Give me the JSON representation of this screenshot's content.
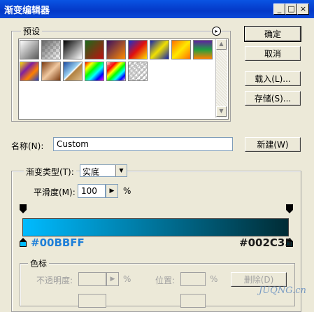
{
  "window": {
    "title": "渐变编辑器",
    "min_glyph": "_",
    "max_glyph": "□",
    "close_glyph": "×"
  },
  "presets": {
    "label": "预设",
    "menu_glyph": "▸",
    "scroll_up": "▲",
    "scroll_down": "▼",
    "swatches": [
      {
        "name": "foreground-to-background",
        "css": "linear-gradient(135deg,#ffffff,#5a5a5a)"
      },
      {
        "name": "foreground-to-transparent",
        "css": "linear-gradient(135deg,#666 0%,rgba(255,255,255,0) 100%)",
        "checker": true
      },
      {
        "name": "black-white",
        "css": "linear-gradient(135deg,#000,#fff)"
      },
      {
        "name": "red-green",
        "css": "linear-gradient(135deg,#1a6a1a,#c01010)"
      },
      {
        "name": "violet-orange",
        "css": "linear-gradient(135deg,#3a1060,#ff8a00)"
      },
      {
        "name": "blue-red-yellow",
        "css": "linear-gradient(135deg,#1530d0,#e01010 50%,#ffe000)"
      },
      {
        "name": "blue-yellow-blue",
        "css": "linear-gradient(135deg,#1020b0,#f0e000 50%,#1020b0)"
      },
      {
        "name": "orange-yellow-orange",
        "css": "linear-gradient(135deg,#ff7000,#ffe800 50%,#ff7000)"
      },
      {
        "name": "violet-green-orange",
        "css": "linear-gradient(180deg,#6020a0,#20a040 50%,#ff8000)"
      },
      {
        "name": "yellow-violet-orange-blue",
        "css": "linear-gradient(135deg,#ffe000,#8020a0 35%,#ff8000 65%,#2040d0)"
      },
      {
        "name": "copper",
        "css": "linear-gradient(135deg,#7a3a10,#f0c8a0 50%,#7a3a10)"
      },
      {
        "name": "chrome",
        "css": "linear-gradient(135deg,#1a4aa0,#9ad0f0 45%,#fff 50%,#b08040 55%,#e0c090)"
      },
      {
        "name": "spectrum",
        "css": "linear-gradient(135deg,#f00,#ff0 20%,#0f0 40%,#0ff 60%,#00f 80%,#f0f)"
      },
      {
        "name": "transparent-rainbow",
        "css": "linear-gradient(135deg,rgba(255,0,0,0.2),#f00 25%,#ff0 40%,#0f0 55%,#0ff 70%,#00f 85%,rgba(255,0,255,0.2))",
        "checker": true
      },
      {
        "name": "transparent-stripes",
        "css": "repeating-linear-gradient(135deg,rgba(255,255,255,0) 0 3px,rgba(160,160,160,0.6) 3px 5px)",
        "checker": true
      }
    ]
  },
  "buttons": {
    "ok": "确定",
    "cancel": "取消",
    "load": "载入(L)...",
    "save": "存储(S)...",
    "new": "新建(W)"
  },
  "name": {
    "label": "名称(N):",
    "value": "Custom"
  },
  "gradient": {
    "type_label": "渐变类型(T):",
    "type_value": "实底",
    "smoothness_label": "平滑度(M):",
    "smoothness_value": "100",
    "percent": "%",
    "stepper_glyph": "▶",
    "combo_glyph": "▼",
    "start_color": "#00BBFF",
    "end_color": "#002C35",
    "start_label": "#00BBFF",
    "end_label": "#002C35"
  },
  "stops": {
    "label": "色标",
    "opacity_label": "不透明度:",
    "opacity_unit": "%",
    "location_label": "位置:",
    "location_unit": "%",
    "delete_button": "删除(D)"
  },
  "watermark": "JUQNG.cn"
}
